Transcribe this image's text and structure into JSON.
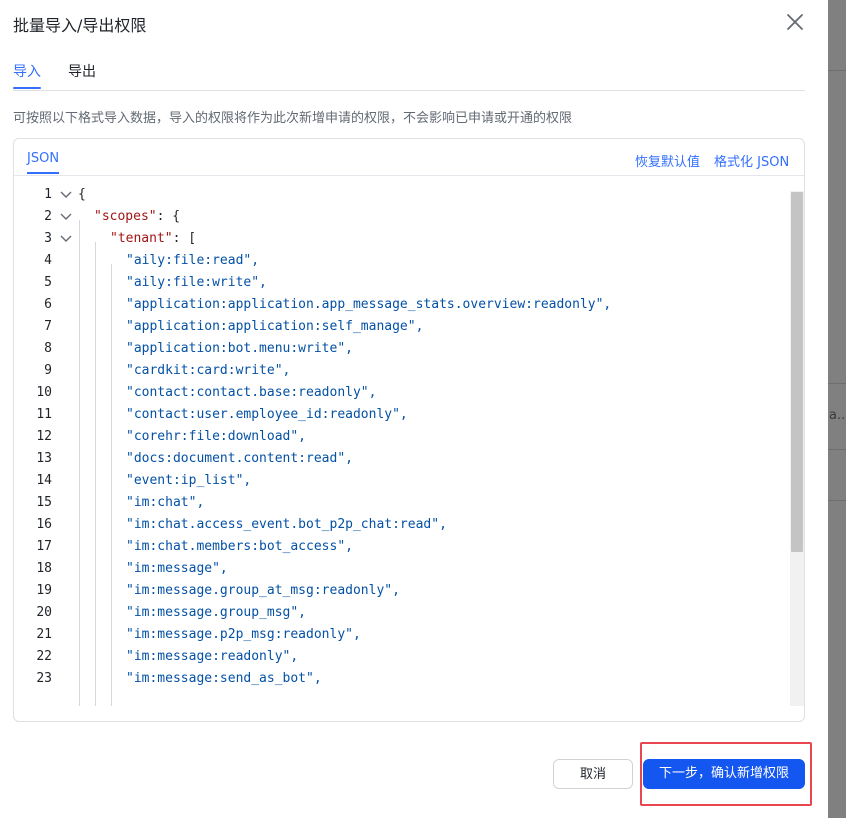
{
  "dialog": {
    "title": "批量导入/导出权限",
    "tabs": [
      {
        "label": "导入",
        "active": true
      },
      {
        "label": "导出",
        "active": false
      }
    ],
    "hint": "可按照以下格式导入数据，导入的权限将作为此次新增申请的权限，不会影响已申请或开通的权限"
  },
  "editor": {
    "mode_tab": "JSON",
    "restore_default": "恢复默认值",
    "format_json": "格式化 JSON",
    "lines": [
      {
        "n": "1",
        "text": "{"
      },
      {
        "n": "2",
        "key": "\"scopes\"",
        "text": ": {"
      },
      {
        "n": "3",
        "key": "\"tenant\"",
        "text": ": ["
      },
      {
        "n": "4",
        "text": "\"aily:file:read\","
      },
      {
        "n": "5",
        "text": "\"aily:file:write\","
      },
      {
        "n": "6",
        "text": "\"application:application.app_message_stats.overview:readonly\","
      },
      {
        "n": "7",
        "text": "\"application:application:self_manage\","
      },
      {
        "n": "8",
        "text": "\"application:bot.menu:write\","
      },
      {
        "n": "9",
        "text": "\"cardkit:card:write\","
      },
      {
        "n": "10",
        "text": "\"contact:contact.base:readonly\","
      },
      {
        "n": "11",
        "text": "\"contact:user.employee_id:readonly\","
      },
      {
        "n": "12",
        "text": "\"corehr:file:download\","
      },
      {
        "n": "13",
        "text": "\"docs:document.content:read\","
      },
      {
        "n": "14",
        "text": "\"event:ip_list\","
      },
      {
        "n": "15",
        "text": "\"im:chat\","
      },
      {
        "n": "16",
        "text": "\"im:chat.access_event.bot_p2p_chat:read\","
      },
      {
        "n": "17",
        "text": "\"im:chat.members:bot_access\","
      },
      {
        "n": "18",
        "text": "\"im:message\","
      },
      {
        "n": "19",
        "text": "\"im:message.group_at_msg:readonly\","
      },
      {
        "n": "20",
        "text": "\"im:message.group_msg\","
      },
      {
        "n": "21",
        "text": "\"im:message.p2p_msg:readonly\","
      },
      {
        "n": "22",
        "text": "\"im:message:readonly\","
      },
      {
        "n": "23",
        "text": "\"im:message:send_as_bot\","
      }
    ]
  },
  "footer": {
    "cancel": "取消",
    "next": "下一步，确认新增权限"
  },
  "background": {
    "peek_text": "a..."
  },
  "colors": {
    "accent": "#3370ff",
    "primary_button": "#1456f0",
    "highlight_box": "#e8474f",
    "json_key": "#a31515",
    "json_string": "#0451a5"
  }
}
